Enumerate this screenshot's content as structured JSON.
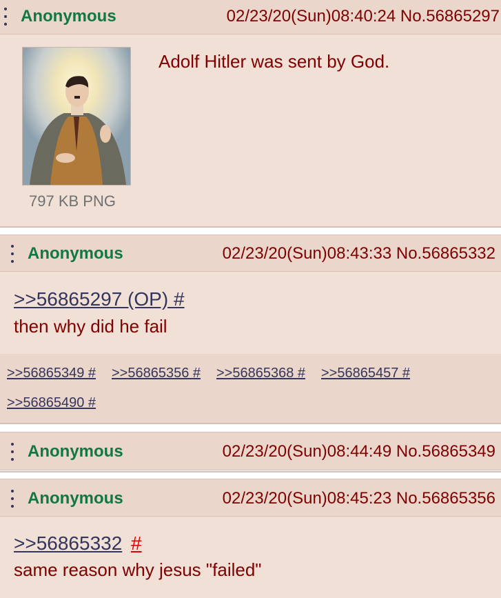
{
  "op": {
    "name": "Anonymous",
    "meta": "02/23/20(Sun)08:40:24 No.56865297",
    "message": "Adolf Hitler was sent by God.",
    "file_info": "797 KB PNG"
  },
  "reply1": {
    "name": "Anonymous",
    "meta": "02/23/20(Sun)08:43:33 No.56865332",
    "quote": ">>56865297 (OP) #",
    "message": "then why did he fail",
    "backlinks": [
      ">>56865349 #",
      ">>56865356 #",
      ">>56865368 #",
      ">>56865457 #",
      ">>56865490 #"
    ]
  },
  "reply2": {
    "name": "Anonymous",
    "meta": "02/23/20(Sun)08:44:49 No.56865349"
  },
  "reply3": {
    "name": "Anonymous",
    "meta": "02/23/20(Sun)08:45:23 No.56865356",
    "quote": ">>56865332",
    "quote_hash": "#",
    "message": "same reason why jesus \"failed\""
  },
  "colors": {
    "name": "#117743",
    "text": "#800000",
    "link": "#34345c",
    "header_bg": "#ead6ca",
    "body_bg": "#f0e0d6",
    "hash_red": "#dd0000"
  }
}
